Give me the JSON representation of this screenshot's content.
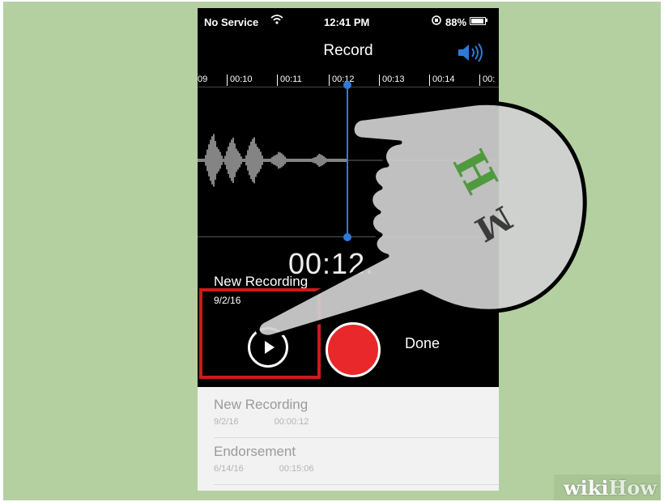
{
  "status_bar": {
    "carrier": "No Service",
    "time": "12:41 PM",
    "battery": "88%",
    "wifi_icon": "wifi-icon",
    "lock_icon": "orientation-lock-icon"
  },
  "header": {
    "title": "Record",
    "speaker_icon": "speaker-icon"
  },
  "timeline": {
    "ticks": [
      "00:10",
      "00:11",
      "00:12",
      "00:13",
      "00:14"
    ],
    "left_partial": "09",
    "right_partial": "00:"
  },
  "elapsed": "00:12.",
  "recording": {
    "name": "New Recording",
    "date": "9/2/16"
  },
  "controls": {
    "play_icon": "play-icon",
    "record_icon": "record-icon",
    "done_label": "Done"
  },
  "recordings": [
    {
      "name": "New Recording",
      "date": "9/2/16",
      "duration": "00:00:12"
    },
    {
      "name": "Endorsement",
      "date": "6/14/16",
      "duration": "00:15:06"
    }
  ],
  "colors": {
    "background": "#b4d0a1",
    "accent": "#2e7bd6",
    "record": "#e8282a",
    "highlight": "#cf1a1a"
  },
  "watermark": {
    "wiki": "wiki",
    "how": "How"
  }
}
